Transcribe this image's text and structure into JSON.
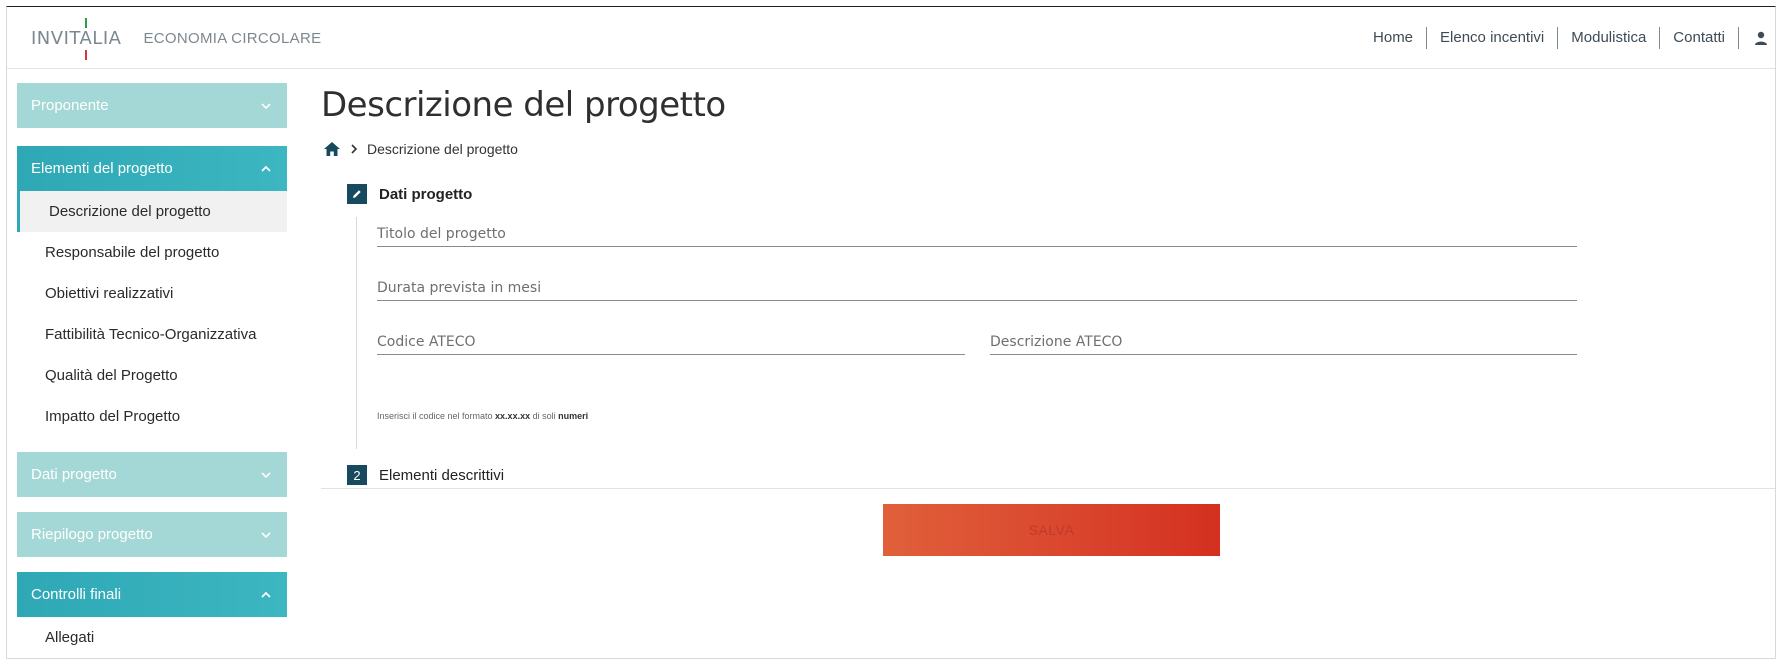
{
  "header": {
    "logo_text": "INVITALIA",
    "logo_sub": "ECONOMIA CIRCOLARE",
    "nav": [
      "Home",
      "Elenco incentivi",
      "Modulistica",
      "Contatti"
    ]
  },
  "sidebar": {
    "sections": [
      {
        "label": "Proponente",
        "expanded": false
      },
      {
        "label": "Elementi del progetto",
        "expanded": true,
        "items": [
          "Descrizione del progetto",
          "Responsabile del progetto",
          "Obiettivi realizzativi",
          "Fattibilità Tecnico-Organizzativa",
          "Qualità del Progetto",
          "Impatto del Progetto"
        ]
      },
      {
        "label": "Dati progetto",
        "expanded": false
      },
      {
        "label": "Riepilogo progetto",
        "expanded": false
      },
      {
        "label": "Controlli finali",
        "expanded": true,
        "items": [
          "Allegati"
        ]
      }
    ],
    "active_item": "Descrizione del progetto"
  },
  "main": {
    "title": "Descrizione del progetto",
    "breadcrumb": "Descrizione del progetto",
    "steps": [
      {
        "badge": "",
        "label": "Dati progetto"
      },
      {
        "badge": "2",
        "label": "Elementi descrittivi"
      }
    ],
    "fields": {
      "titolo": {
        "placeholder": "Titolo del progetto",
        "value": ""
      },
      "durata": {
        "placeholder": "Durata prevista in mesi",
        "value": ""
      },
      "codice_ateco": {
        "placeholder": "Codice ATECO",
        "value": ""
      },
      "descrizione_ateco": {
        "placeholder": "Descrizione ATECO",
        "value": ""
      }
    },
    "hint": {
      "prefix": "Inserisci il codice nel formato ",
      "format": "xx.xx.xx",
      "middle": " di soli ",
      "suffix": "numeri"
    },
    "save_label": "SALVA"
  },
  "colors": {
    "accent": "#2fa8b6",
    "sidebar_light": "#a3d8d6",
    "step_badge": "#17495f",
    "save_button": "#d9442d"
  }
}
